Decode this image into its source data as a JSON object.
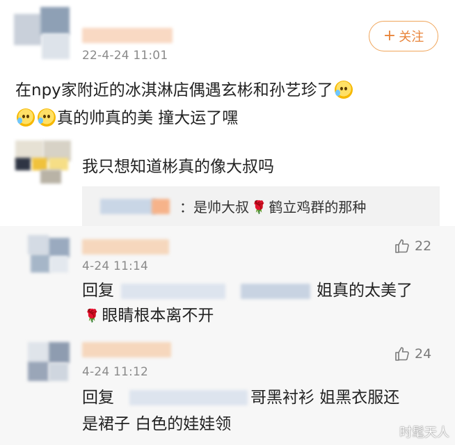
{
  "comment1": {
    "time": "22-4-24 11:01",
    "follow_label": "关注",
    "follow_plus": "+",
    "line1": "在npy家附近的冰淇淋店偶遇玄彬和孙艺珍了",
    "line2": "真的帅真的美 撞大运了嘿"
  },
  "comment2": {
    "text": "我只想知道彬真的像大叔吗",
    "nested": {
      "text": "：是帅大叔",
      "text_after_rose": "鹤立鸡群的那种"
    }
  },
  "reply1": {
    "time": "4-24 11:14",
    "likes": "22",
    "prefix": "回复",
    "text_after_mask": "姐真的太美了",
    "line2": "眼睛根本离不开"
  },
  "reply2": {
    "time": "4-24 11:12",
    "likes": "24",
    "prefix": "回复",
    "text_after_mask": "哥黑衬衫 姐黑衣服还",
    "line2": "是裙子 白色的娃娃领"
  },
  "watermark": "时髦天人",
  "colors": {
    "accent": "#e8843a",
    "meta": "#8a8a8a",
    "reply_bg": "#f2f2f2"
  }
}
